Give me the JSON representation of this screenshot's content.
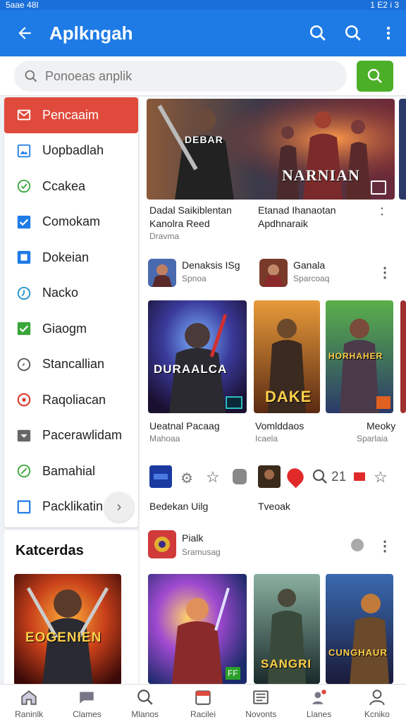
{
  "status": {
    "left": "5aae 48I",
    "right": "1 E2 i 3"
  },
  "appbar": {
    "title": "Aplkngah",
    "back_icon": "arrow-left-icon",
    "actions": [
      "search-icon",
      "search-icon",
      "more-vert-icon"
    ]
  },
  "search": {
    "placeholder": "Ponoeas anplik",
    "button_icon": "search-icon",
    "accent": "#4caf28"
  },
  "sidebar": {
    "items": [
      {
        "label": "Pencaaim",
        "icon": "mail-icon",
        "active": true
      },
      {
        "label": "Uopbadlah",
        "icon": "image-icon"
      },
      {
        "label": "Ccakea",
        "icon": "check-circle-icon"
      },
      {
        "label": "Comokam",
        "icon": "checkbox-icon"
      },
      {
        "label": "Dokeian",
        "icon": "square-icon"
      },
      {
        "label": "Nacko",
        "icon": "clock-icon"
      },
      {
        "label": "Giaogm",
        "icon": "checkbox-green-icon"
      },
      {
        "label": "Stancallian",
        "icon": "compass-icon"
      },
      {
        "label": "Raqoliacan",
        "icon": "refresh-icon"
      },
      {
        "label": "Pacerawlidam",
        "icon": "dropdown-box-icon"
      },
      {
        "label": "Bamahial",
        "icon": "circle-slash-icon"
      },
      {
        "label": "Packlikatin",
        "icon": "square-outline-icon"
      }
    ],
    "more_icon": "chevron-right-icon",
    "active_color": "#e04a3c"
  },
  "featured": {
    "heading": "Katcerdas",
    "art_label": "EOGENIEN"
  },
  "banner": {
    "left_art_label": "DEBAR",
    "title_art": "NARNIAN",
    "caption_left_1": "Dadal Saikiblentan",
    "caption_left_2": "Kanolra Reed",
    "caption_left_3": "Dravma",
    "caption_right_1": "Etanad Ihanaotan",
    "caption_right_2": "Apdhnaraik"
  },
  "app_rows": [
    {
      "name": "Denaksis ISg",
      "sub": "Spnoa"
    },
    {
      "name": "Ganala",
      "sub": "Sparcoaq"
    }
  ],
  "games_row1": [
    {
      "art": "DURAALCA",
      "title": "Ueatnal Pacaag",
      "sub": "Mahoaa"
    },
    {
      "art": "DAKE",
      "title": "Vomlddaos",
      "sub": "Icaela"
    },
    {
      "art": "HORHAHER",
      "title": "Meoky",
      "sub": "Sparlaia"
    }
  ],
  "mini_row": {
    "count": "21",
    "left_label": "Bedekan Uilg",
    "right_label": "Tveoak"
  },
  "app_row3": {
    "name": "Pialk",
    "sub": "Sramusag"
  },
  "games_row2": [
    {
      "art": "",
      "corner": "FF"
    },
    {
      "art": "SANGRI"
    },
    {
      "art": "CUNGHAUR"
    }
  ],
  "tabs": [
    {
      "label": "Raninlk",
      "icon": "home-icon"
    },
    {
      "label": "Clames",
      "icon": "chat-icon"
    },
    {
      "label": "Mlanos",
      "icon": "search-icon"
    },
    {
      "label": "Racilei",
      "icon": "calendar-icon"
    },
    {
      "label": "Novonts",
      "icon": "inbox-icon"
    },
    {
      "label": "Llanes",
      "icon": "people-icon"
    },
    {
      "label": "Kcniko",
      "icon": "person-icon"
    }
  ]
}
